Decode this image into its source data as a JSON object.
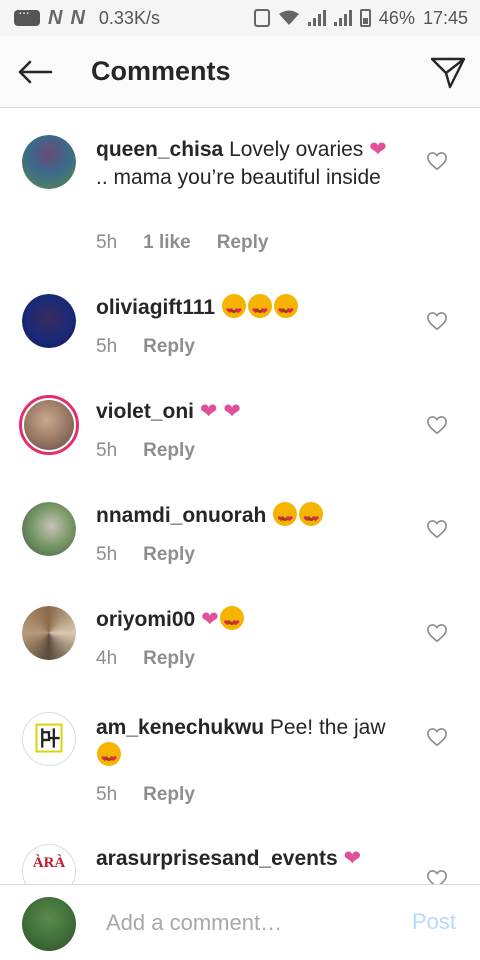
{
  "status_bar": {
    "carrier_1": "N",
    "carrier_2": "N",
    "speed": "0.33K/s",
    "battery": "46%",
    "time": "17:45"
  },
  "header": {
    "title": "Comments",
    "back_icon": "arrow-left-icon",
    "send_icon": "paper-plane-icon"
  },
  "comments": [
    {
      "username": "queen_chisa",
      "text_a": " Lovely ovaries ",
      "heart": "❤",
      "text_b": ".. mama you’re beautiful inside",
      "time": "5h",
      "likes": "1 like",
      "reply": "Reply"
    },
    {
      "username": "oliviagift111",
      "time": "5h",
      "reply": "Reply"
    },
    {
      "username": "violet_oni",
      "hearts": "❤ ❤",
      "time": "5h",
      "reply": "Reply"
    },
    {
      "username": "nnamdi_onuorah",
      "time": "5h",
      "reply": "Reply"
    },
    {
      "username": "oriyomi00",
      "heart": "❤",
      "time": "4h",
      "reply": "Reply"
    },
    {
      "username": "am_kenechukwu",
      "text": " Pee! the jaw ",
      "time": "5h",
      "reply": "Reply"
    },
    {
      "username": "arasurprisesand_events",
      "heart": "❤",
      "avatar_text": "ÀRÀ"
    }
  ],
  "composer": {
    "placeholder": "Add a comment…",
    "post_label": "Post"
  },
  "colors": {
    "heart": "#e0509a",
    "post_disabled": "#b3dbff",
    "meta_gray": "#8e8e8e",
    "story_ring": "#e1306c"
  }
}
